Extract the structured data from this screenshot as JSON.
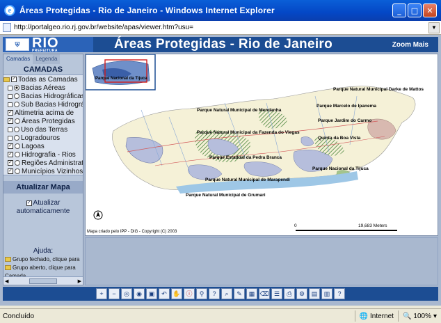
{
  "window": {
    "title": "Áreas Protegidas - Rio de Janeiro - Windows Internet Explorer",
    "icon": "ie-icon"
  },
  "address": {
    "url": "http://portalgeo.rio.rj.gov.br/website/apas/viewer.htm?usu="
  },
  "banner": {
    "logo": "RIO",
    "logo_sub": "PREFEITURA",
    "title": "Áreas Protegidas - Rio de Janeiro",
    "zoom": "Zoom Mais"
  },
  "sidebar": {
    "tabs": [
      "Camadas",
      "Legenda"
    ],
    "header": "CAMADAS",
    "layers": [
      {
        "label": "Todas as Camadas"
      },
      {
        "label": "Bacias Aéreas"
      },
      {
        "label": "Bacias Hidrográficas"
      },
      {
        "label": "Sub Bacias Hidrográficas"
      },
      {
        "label": "Altimetria acima de"
      },
      {
        "label": "Áreas Protegidas"
      },
      {
        "label": "Uso das Terras"
      },
      {
        "label": "Logradouros"
      },
      {
        "label": "Lagoas"
      },
      {
        "label": "Hidrografia - Rios"
      },
      {
        "label": "Regiões Administrativas"
      },
      {
        "label": "Municípios Vizinhos"
      }
    ],
    "update_header": "Atualizar Mapa",
    "auto_label_1": "Atualizar",
    "auto_label_2": "automaticamente",
    "help_title": "Ajuda:",
    "help_1": "Grupo fechado, clique para",
    "help_2": "Grupo aberto, clique para",
    "help_3": "Camada."
  },
  "map": {
    "overview_label": "Parque Nacional da Tijuca",
    "labels": [
      "Parque Natural Municipal Darke de Mattos",
      "Parque Natural Municipal de Mendanha",
      "Parque Marcelo de Ipanema",
      "Parque Jardim do Carmo",
      "Parque Natural Municipal da Fazenda do Viegas",
      "Quinta da Boa Vista",
      "Parque Estadual da Pedra Branca",
      "Parque Nacional da Tijuca",
      "Parque Natural Municipal de Marapendi",
      "Parque Natural Municipal de Grumari"
    ],
    "copyright": "Mapa criado pelo IPP - DIG - Copyright (C) 2003",
    "scale_start": "0",
    "scale_end": "19,683 Meters",
    "north": "N"
  },
  "toolbar": {
    "tools": [
      "zoom-in-icon",
      "zoom-out-icon",
      "zoom-full-icon",
      "zoom-layer-icon",
      "zoom-active-icon",
      "zoom-back-icon",
      "pan-icon",
      "identify-icon",
      "find-icon",
      "query-icon",
      "search-icon",
      "measure-icon",
      "select-icon",
      "clear-icon",
      "legend-icon",
      "print-icon",
      "options-icon",
      "overview-icon",
      "layer-list-icon",
      "help-icon"
    ]
  },
  "status": {
    "left": "Concluído",
    "zone": "Internet",
    "zoom": "100%"
  }
}
